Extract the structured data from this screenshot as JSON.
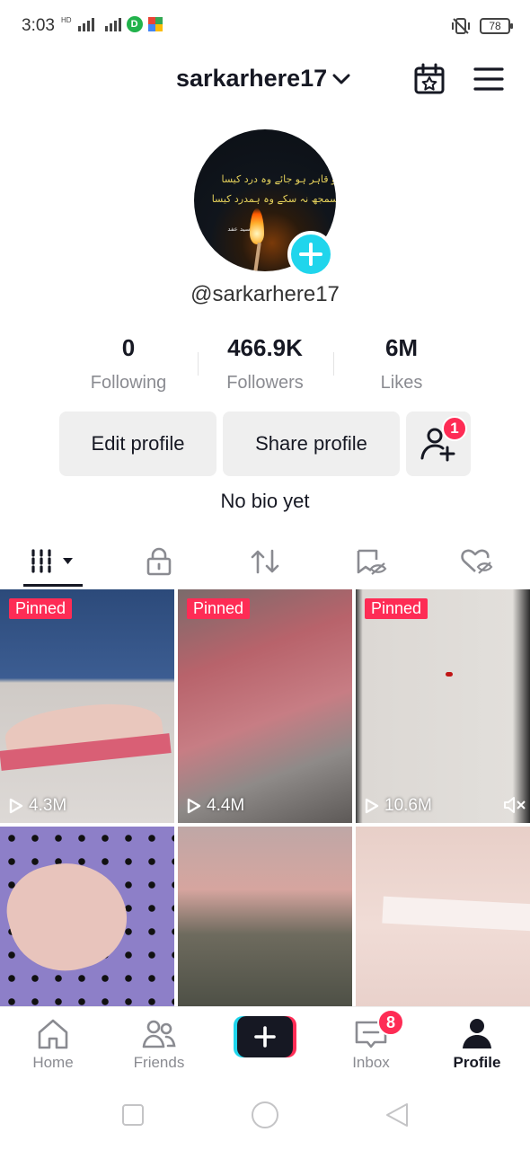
{
  "status_bar": {
    "time": "3:03",
    "battery": "78",
    "hd_label": "HD",
    "app_letter": "D"
  },
  "header": {
    "username": "sarkarhere17"
  },
  "profile": {
    "avatar_text_line1": "جو قاہر ہو جائے وہ درد کیسا",
    "avatar_text_line2": "جو سمجھ نہ سکے وہ ہمدرد کیسا",
    "avatar_signature": "سید عفد",
    "handle": "@sarkarhere17",
    "stats": [
      {
        "value": "0",
        "label": "Following"
      },
      {
        "value": "466.9K",
        "label": "Followers"
      },
      {
        "value": "6M",
        "label": "Likes"
      }
    ],
    "edit_label": "Edit profile",
    "share_label": "Share profile",
    "friend_badge": "1",
    "bio": "No bio yet"
  },
  "tabs": [
    "videos",
    "private",
    "reposts",
    "favorites",
    "liked"
  ],
  "videos": [
    {
      "pinned": "Pinned",
      "views": "4.3M",
      "bg": "#d8d4d2"
    },
    {
      "pinned": "Pinned",
      "views": "4.4M",
      "bg": "#b56b6e"
    },
    {
      "pinned": "Pinned",
      "views": "10.6M",
      "bg": "#dedad6"
    },
    {
      "pinned": "",
      "views": "",
      "bg": "#8d7fc8"
    },
    {
      "pinned": "",
      "views": "",
      "bg": "#8b8270"
    },
    {
      "pinned": "",
      "views": "",
      "bg": "#ead5d0"
    }
  ],
  "nav": {
    "home": "Home",
    "friends": "Friends",
    "inbox": "Inbox",
    "inbox_badge": "8",
    "profile": "Profile"
  },
  "colors": {
    "accent": "#fe2c55",
    "cyan": "#20d5ec",
    "text": "#161823",
    "muted": "#8a8b91"
  }
}
